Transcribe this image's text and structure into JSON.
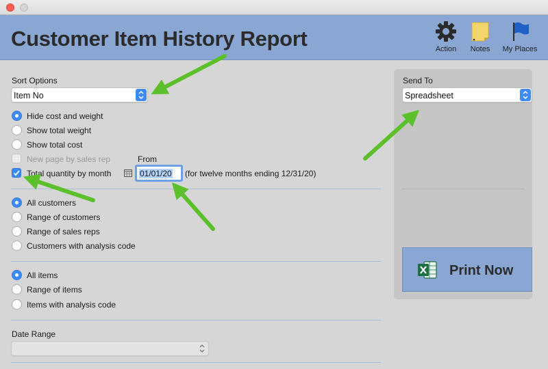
{
  "window": {
    "title": "Customer Item History Report"
  },
  "toolbar": {
    "action_label": "Action",
    "notes_label": "Notes",
    "places_label": "My Places"
  },
  "sort": {
    "label": "Sort Options",
    "value": "Item No"
  },
  "cost_options": [
    {
      "label": "Hide cost and weight",
      "selected": true
    },
    {
      "label": "Show total weight",
      "selected": false
    },
    {
      "label": "Show total cost",
      "selected": false
    }
  ],
  "new_page": {
    "label": "New page by sales rep",
    "checked": false,
    "enabled": false
  },
  "total_qty": {
    "label": "Total quantity by month",
    "checked": true
  },
  "from": {
    "label": "From",
    "value": "01/01/20",
    "note": "(for twelve months ending 12/31/20)"
  },
  "customer_options": [
    {
      "label": "All customers",
      "selected": true
    },
    {
      "label": "Range of customers",
      "selected": false
    },
    {
      "label": "Range of sales reps",
      "selected": false
    },
    {
      "label": "Customers with analysis code",
      "selected": false
    }
  ],
  "item_options": [
    {
      "label": "All items",
      "selected": true
    },
    {
      "label": "Range of items",
      "selected": false
    },
    {
      "label": "Items with analysis code",
      "selected": false
    }
  ],
  "date_range": {
    "label": "Date Range",
    "value": ""
  },
  "send_to": {
    "label": "Send To",
    "value": "Spreadsheet"
  },
  "print": {
    "label": "Print Now"
  },
  "colors": {
    "header": "#8aa7d4",
    "accent": "#3d8bf7",
    "arrow": "#5cc02a"
  }
}
